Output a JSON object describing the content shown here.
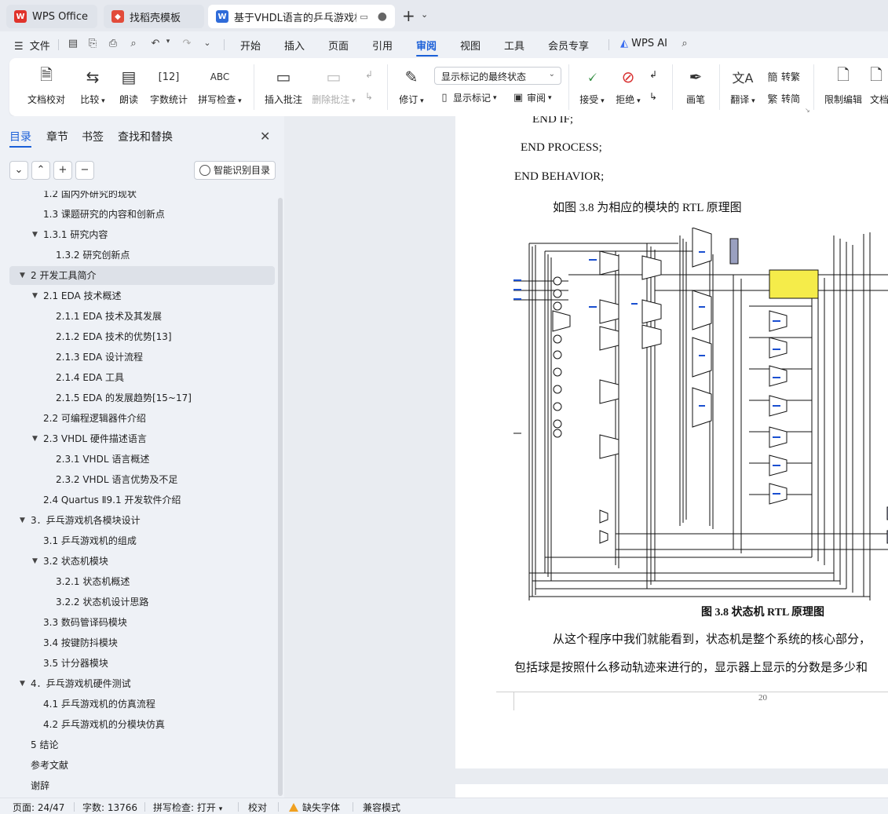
{
  "tabs": {
    "wps": "WPS Office",
    "templates": "找稻壳模板",
    "document": "基于VHDL语言的乒乓游戏机电"
  },
  "menubar": {
    "file": "文件",
    "items": [
      "开始",
      "插入",
      "页面",
      "引用",
      "审阅",
      "视图",
      "工具",
      "会员专享"
    ],
    "active": "审阅",
    "wps_ai": "WPS AI"
  },
  "ribbon": {
    "doc_check": "文档校对",
    "compare": "比较",
    "read_aloud": "朗读",
    "word_count": "字数统计",
    "spell_check": "拼写检查",
    "insert_comment": "插入批注",
    "delete_comment": "删除批注",
    "track_changes": "修订",
    "display_mode": "显示标记的最终状态",
    "show_markup": "显示标记",
    "review_pane": "审阅",
    "accept": "接受",
    "reject": "拒绝",
    "pen": "画笔",
    "translate": "翻译",
    "to_traditional": "转繁",
    "to_simplified": "转简",
    "restrict_editing": "限制编辑",
    "doc_more": "文档"
  },
  "nav_panel": {
    "tabs": [
      "目录",
      "章节",
      "书签",
      "查找和替换"
    ],
    "active_tab": "目录",
    "smart_toc": "智能识别目录",
    "toc": [
      {
        "text": "1.2 国内外研究的现状",
        "level": 2
      },
      {
        "text": "1.3 课题研究的内容和创新点",
        "level": 2
      },
      {
        "text": "1.3.1  研究内容",
        "level": 2,
        "expanded": true
      },
      {
        "text": "1.3.2  研究创新点",
        "level": 3
      },
      {
        "text": "2  开发工具简介",
        "level": 1,
        "expanded": true,
        "selected": true
      },
      {
        "text": "2.1 EDA 技术概述",
        "level": 2,
        "expanded": true
      },
      {
        "text": "2.1.1 EDA 技术及其发展",
        "level": 3
      },
      {
        "text": "2.1.2 EDA 技术的优势[13]",
        "level": 3
      },
      {
        "text": "2.1.3 EDA 设计流程",
        "level": 3
      },
      {
        "text": "2.1.4 EDA 工具",
        "level": 3
      },
      {
        "text": "2.1.5 EDA 的发展趋势[15~17]",
        "level": 3
      },
      {
        "text": "2.2 可编程逻辑器件介绍",
        "level": 2
      },
      {
        "text": "2.3 VHDL 硬件描述语言",
        "level": 2,
        "expanded": true
      },
      {
        "text": "2.3.1 VHDL 语言概述",
        "level": 3
      },
      {
        "text": "2.3.2 VHDL 语言优势及不足",
        "level": 3
      },
      {
        "text": "2.4 Quartus Ⅱ9.1 开发软件介绍",
        "level": 2
      },
      {
        "text": "3．乒乓游戏机各模块设计",
        "level": 1,
        "expanded": true
      },
      {
        "text": "3.1 乒乓游戏机的组成",
        "level": 2
      },
      {
        "text": "3.2 状态机模块",
        "level": 2,
        "expanded": true
      },
      {
        "text": "3.2.1  状态机概述",
        "level": 3
      },
      {
        "text": "3.2.2  状态机设计思路",
        "level": 3
      },
      {
        "text": "3.3 数码管译码模块",
        "level": 2
      },
      {
        "text": "3.4 按键防抖模块",
        "level": 2
      },
      {
        "text": "3.5 计分器模块",
        "level": 2
      },
      {
        "text": "4．乒乓游戏机硬件测试",
        "level": 1,
        "expanded": true
      },
      {
        "text": "4.1 乒乓游戏机的仿真流程",
        "level": 2
      },
      {
        "text": "4.2 乒乓游戏机的分模块仿真",
        "level": 2
      },
      {
        "text": "5  结论",
        "level": 1
      },
      {
        "text": "参考文献",
        "level": 1
      },
      {
        "text": "谢辞",
        "level": 1
      }
    ]
  },
  "document": {
    "code_lines": [
      "END IF;",
      "END PROCESS;",
      "END BEHAVIOR;"
    ],
    "intro": "如图 3.8 为相应的模块的 RTL 原理图",
    "caption": "图 3.8  状态机 RTL 原理图",
    "para1": "从这个程序中我们就能看到，状态机是整个系统的核心部分，",
    "para2": "包括球是按照什么移动轨迹来进行的，显示器上显示的分数是多少和",
    "page_number": "20"
  },
  "statusbar": {
    "page": "页面: 24/47",
    "words": "字数: 13766",
    "spell": "拼写检查: 打开",
    "proof": "校对",
    "missing_font": "缺失字体",
    "compat": "兼容模式"
  },
  "colors": {
    "accent": "#1a5fd8",
    "wps_red": "#e0332b",
    "doc_blue": "#2f6bd9"
  }
}
